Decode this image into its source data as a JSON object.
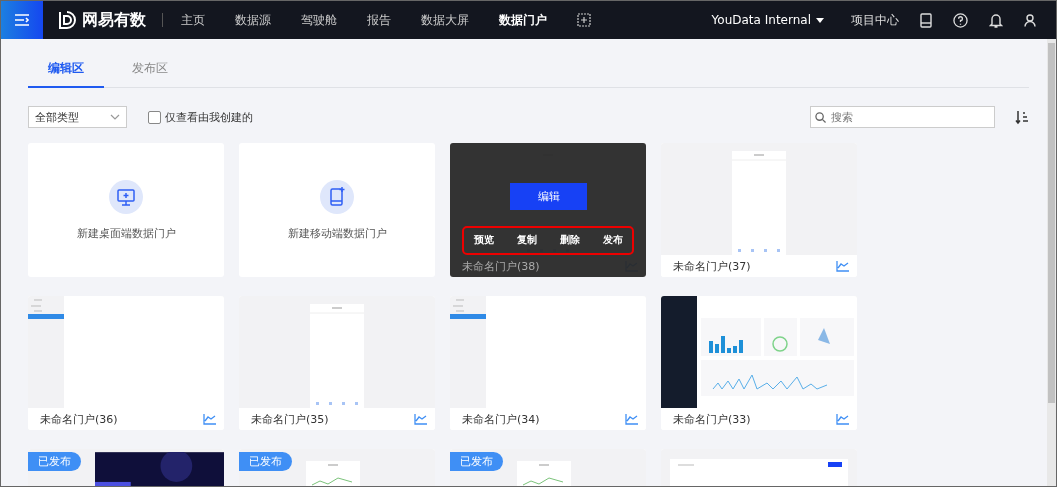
{
  "nav": {
    "brand": "网易有数",
    "items": [
      {
        "label": "主页",
        "selected": false
      },
      {
        "label": "数据源",
        "selected": false
      },
      {
        "label": "驾驶舱",
        "selected": false
      },
      {
        "label": "报告",
        "selected": false
      },
      {
        "label": "数据大屏",
        "selected": false
      },
      {
        "label": "数据门户",
        "selected": true
      }
    ],
    "project": "YouData Internal",
    "project_center": "项目中心"
  },
  "tabs": [
    {
      "label": "编辑区",
      "selected": true
    },
    {
      "label": "发布区",
      "selected": false
    }
  ],
  "filters": {
    "type_select": "全部类型",
    "only_mine": {
      "label": "仅查看由我创建的",
      "checked": false
    },
    "search": {
      "placeholder": "搜索"
    }
  },
  "cards": [
    {
      "kind": "create",
      "label": "新建桌面端数据门户"
    },
    {
      "kind": "create",
      "label": "新建移动端数据门户"
    },
    {
      "kind": "portal",
      "name": "未命名门户(38)",
      "published": false,
      "hovered": true,
      "edit_button": "编辑",
      "actions": [
        "预览",
        "复制",
        "删除",
        "发布"
      ]
    },
    {
      "kind": "portal",
      "name": "未命名门户(37)",
      "published": false,
      "hovered": false
    },
    {
      "kind": "portal",
      "name": "未命名门户(36)",
      "published": false,
      "hovered": false
    },
    {
      "kind": "portal",
      "name": "未命名门户(35)",
      "published": false,
      "hovered": false
    },
    {
      "kind": "portal",
      "name": "未命名门户(34)",
      "published": false,
      "hovered": false
    },
    {
      "kind": "portal",
      "name": "未命名门户(33)",
      "published": false,
      "hovered": false
    },
    {
      "kind": "portal",
      "published": true,
      "badge": "已发布",
      "hovered": false
    },
    {
      "kind": "portal",
      "published": true,
      "badge": "已发布",
      "hovered": false
    },
    {
      "kind": "portal",
      "published": true,
      "badge": "已发布",
      "hovered": false
    },
    {
      "kind": "portal",
      "published": false,
      "hovered": false
    }
  ]
}
